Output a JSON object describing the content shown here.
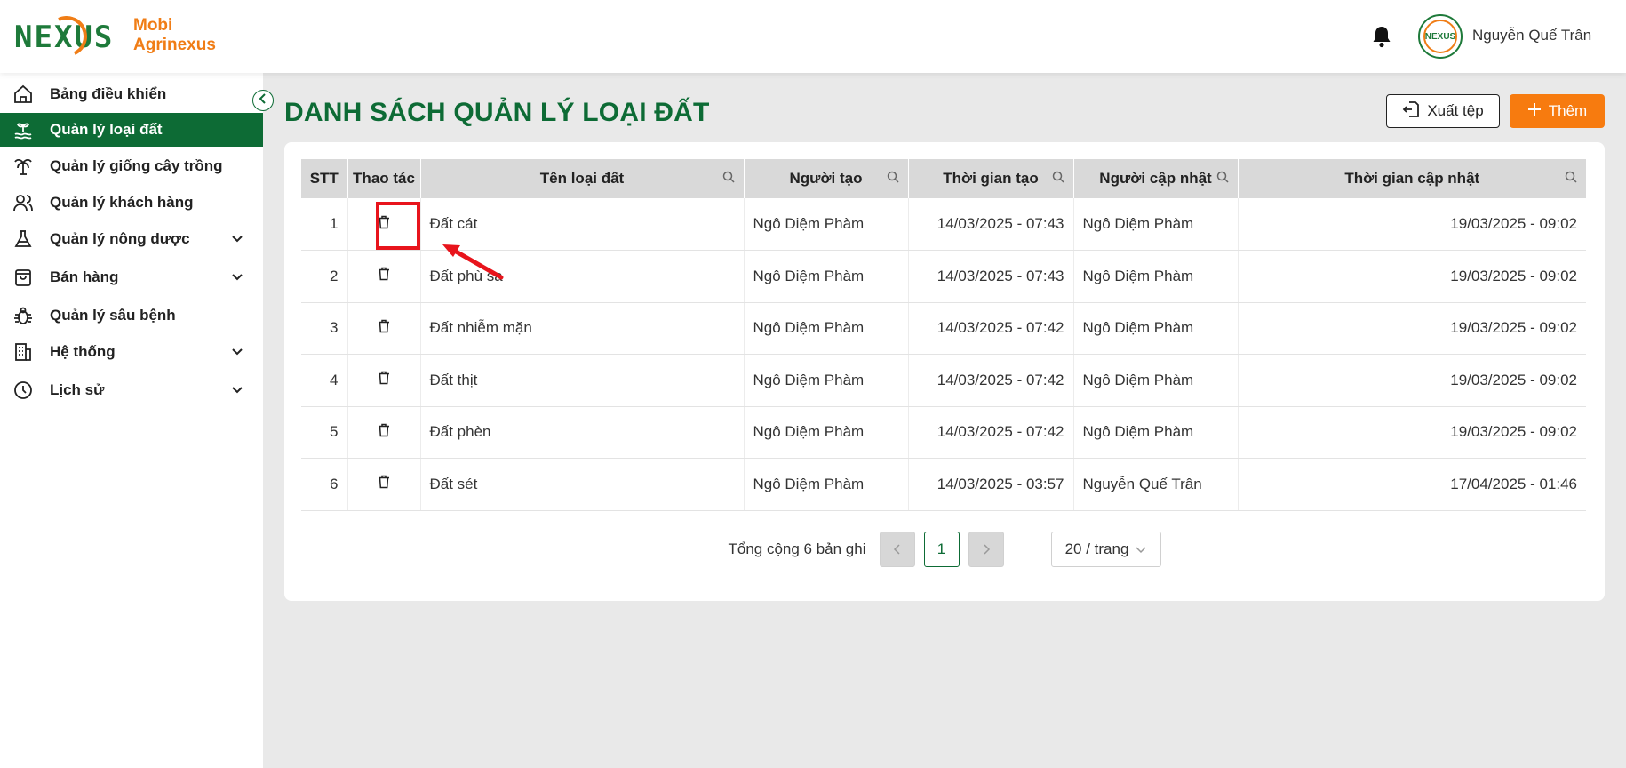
{
  "brand": {
    "logo_word": "NEXUS",
    "line1": "Mobi",
    "line2": "Agrinexus",
    "avatar_text": "NEXUS"
  },
  "user": {
    "name": "Nguyễn Quế Trân"
  },
  "sidebar": {
    "items": [
      {
        "label": "Bảng điều khiển",
        "icon": "home-icon",
        "has_children": false,
        "active": false
      },
      {
        "label": "Quản lý loại đất",
        "icon": "soil-icon",
        "has_children": false,
        "active": true
      },
      {
        "label": "Quản lý giống cây trồng",
        "icon": "palm-tree-icon",
        "has_children": false,
        "active": false
      },
      {
        "label": "Quản lý khách hàng",
        "icon": "users-icon",
        "has_children": false,
        "active": false
      },
      {
        "label": "Quản lý nông dược",
        "icon": "flask-icon",
        "has_children": true,
        "active": false
      },
      {
        "label": "Bán hàng",
        "icon": "shopping-bag-icon",
        "has_children": true,
        "active": false
      },
      {
        "label": "Quản lý sâu bệnh",
        "icon": "bug-icon",
        "has_children": false,
        "active": false
      },
      {
        "label": "Hệ thống",
        "icon": "building-icon",
        "has_children": true,
        "active": false
      },
      {
        "label": "Lịch sử",
        "icon": "history-icon",
        "has_children": true,
        "active": false
      }
    ]
  },
  "page": {
    "title": "DANH SÁCH QUẢN LÝ LOẠI ĐẤT",
    "export_label": "Xuất tệp",
    "add_label": "Thêm"
  },
  "table": {
    "columns": [
      "STT",
      "Thao tác",
      "Tên loại đất",
      "Người tạo",
      "Thời gian tạo",
      "Người cập nhật",
      "Thời gian cập nhật"
    ],
    "rows": [
      {
        "stt": "1",
        "name": "Đất cát",
        "creator": "Ngô Diệm Phàm",
        "created": "14/03/2025 - 07:43",
        "updater": "Ngô Diệm Phàm",
        "updated": "19/03/2025 - 09:02"
      },
      {
        "stt": "2",
        "name": "Đất phù sa",
        "creator": "Ngô Diệm Phàm",
        "created": "14/03/2025 - 07:43",
        "updater": "Ngô Diệm Phàm",
        "updated": "19/03/2025 - 09:02"
      },
      {
        "stt": "3",
        "name": "Đất nhiễm mặn",
        "creator": "Ngô Diệm Phàm",
        "created": "14/03/2025 - 07:42",
        "updater": "Ngô Diệm Phàm",
        "updated": "19/03/2025 - 09:02"
      },
      {
        "stt": "4",
        "name": "Đất thịt",
        "creator": "Ngô Diệm Phàm",
        "created": "14/03/2025 - 07:42",
        "updater": "Ngô Diệm Phàm",
        "updated": "19/03/2025 - 09:02"
      },
      {
        "stt": "5",
        "name": "Đất phèn",
        "creator": "Ngô Diệm Phàm",
        "created": "14/03/2025 - 07:42",
        "updater": "Ngô Diệm Phàm",
        "updated": "19/03/2025 - 09:02"
      },
      {
        "stt": "6",
        "name": "Đất sét",
        "creator": "Ngô Diệm Phàm",
        "created": "14/03/2025 - 03:57",
        "updater": "Nguyễn Quế Trân",
        "updated": "17/04/2025 - 01:46"
      }
    ]
  },
  "pagination": {
    "total_text": "Tổng cộng 6 bản ghi",
    "current_page": "1",
    "page_size": "20 / trang"
  },
  "colors": {
    "primary": "#0d6b35",
    "accent": "#f77b0f",
    "highlight": "#e8141c"
  }
}
